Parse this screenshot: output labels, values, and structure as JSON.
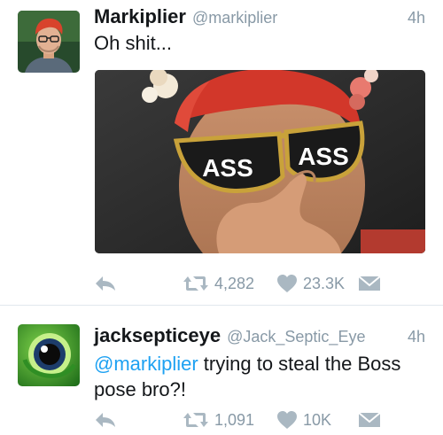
{
  "tweets": [
    {
      "display_name": "Markiplier",
      "handle": "@markiplier",
      "time": "4h",
      "text": "Oh shit...",
      "has_media": true,
      "media_glasses_text": [
        "ASS",
        "ASS"
      ],
      "retweet_count": "4,282",
      "like_count": "23.3K"
    },
    {
      "display_name": "jacksepticeye",
      "handle": "@Jack_Septic_Eye",
      "time": "4h",
      "mention": "@markiplier",
      "text_after_mention": " trying to steal the Boss pose bro?!",
      "retweet_count": "1,091",
      "like_count": "10K"
    }
  ],
  "icons": {
    "reply": "reply-icon",
    "retweet": "retweet-icon",
    "like": "heart-icon",
    "dm": "direct-message-icon"
  },
  "colors": {
    "action_gray": "#aab8c2",
    "meta_gray": "#8899a6",
    "mention_blue": "#1da1f2",
    "avatar2_green": "#3f9b2f"
  }
}
